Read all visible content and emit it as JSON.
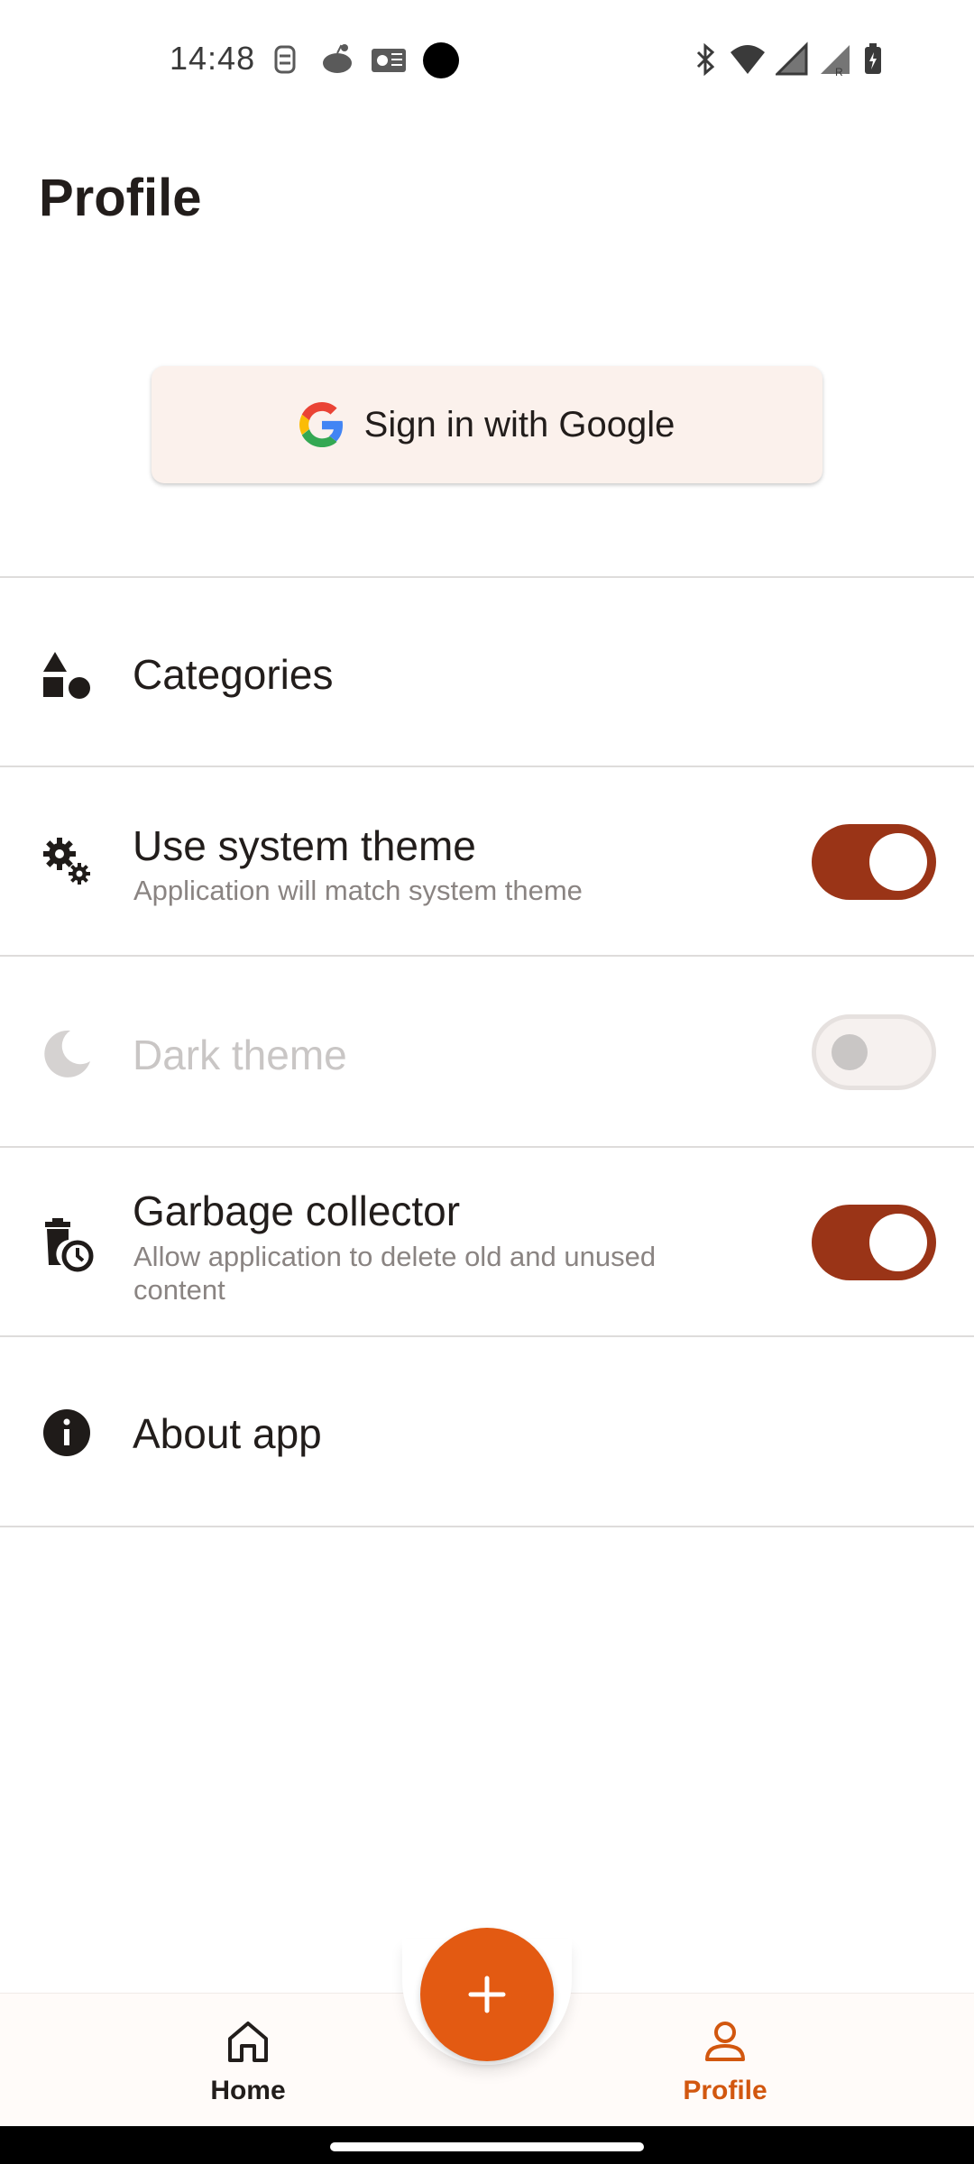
{
  "status_bar": {
    "time": "14:48",
    "notification_icons": [
      "sync-icon",
      "reddit-icon",
      "outlook-icon"
    ],
    "system_icons": [
      "bluetooth-icon",
      "wifi-icon",
      "signal-icon",
      "signal-roaming-icon",
      "battery-charging-icon"
    ]
  },
  "page": {
    "title": "Profile"
  },
  "sign_in": {
    "label": "Sign in with Google"
  },
  "settings": {
    "categories": {
      "title": "Categories"
    },
    "system_theme": {
      "title": "Use system theme",
      "subtitle": "Application will match system theme",
      "enabled": true
    },
    "dark_theme": {
      "title": "Dark theme",
      "enabled": false,
      "disabled": true
    },
    "garbage_collector": {
      "title": "Garbage collector",
      "subtitle": "Allow application to delete old and unused content",
      "enabled": true
    },
    "about": {
      "title": "About app"
    }
  },
  "bottom_nav": {
    "home": {
      "label": "Home"
    },
    "profile": {
      "label": "Profile",
      "active": true
    },
    "fab_icon": "plus-icon"
  },
  "colors": {
    "accent": "#e35a12",
    "switch_on": "#9a3417",
    "button_bg": "#fbf1ec",
    "active_nav": "#d2570f"
  }
}
